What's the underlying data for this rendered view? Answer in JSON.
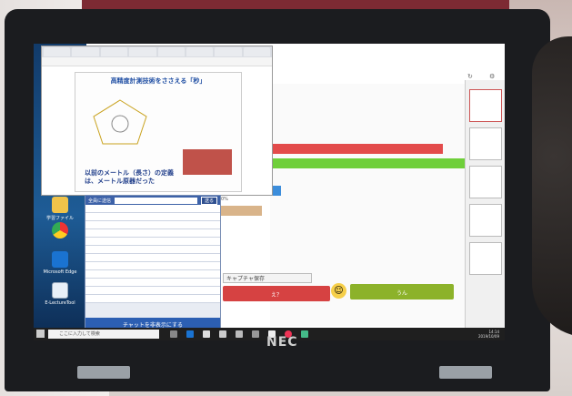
{
  "photo": {
    "laptop_brand": "NEC",
    "screen": {
      "browser": {
        "tabs": [
          "",
          "",
          "",
          "",
          "",
          "",
          "",
          ""
        ],
        "address": "",
        "slide": {
          "title": "高精度計測技術をささえる「秒」",
          "body_line1": "以前のメートル（長さ）の定義",
          "body_line2": "は、メートル原器だった"
        }
      },
      "chat": {
        "header_label": "全員に送信",
        "send_button": "送る",
        "rows": [
          "",
          "",
          "",
          "",
          "",
          "",
          "",
          "",
          "",
          "",
          "",
          ""
        ],
        "footer_button": "チャットを非表示にする"
      },
      "desktop_icons": [
        {
          "label": "学習ファイル"
        },
        {
          "label": ""
        },
        {
          "label": "Microsoft Edge"
        },
        {
          "label": "E-LectureTool"
        }
      ],
      "poll": {
        "bars": [
          {
            "color": "#e34b4b",
            "fraction": 0.89
          },
          {
            "color": "#6fcf3a",
            "fraction": 1.0
          },
          {
            "color": "#3c8ddb",
            "fraction": 0.32
          },
          {
            "color": "#d9b48a",
            "fraction": 0.22
          }
        ],
        "percent_label": "0%"
      },
      "capture_button": "キャプチャ保存",
      "btn_eh": "え？",
      "btn_un": "うん",
      "taskbar": {
        "search_placeholder": "ここに入力して検索",
        "tray_time": "14:14",
        "tray_date": "2019/10/09"
      }
    }
  }
}
